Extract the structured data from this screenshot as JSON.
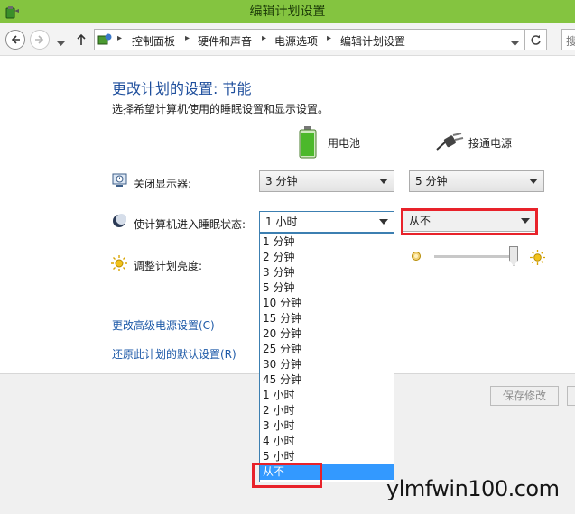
{
  "window": {
    "title": "编辑计划设置"
  },
  "address": {
    "crumbs": [
      "控制面板",
      "硬件和声音",
      "电源选项",
      "编辑计划设置"
    ],
    "search_placeholder": "搜"
  },
  "page": {
    "heading": "更改计划的设置: 节能",
    "subheading": "选择希望计算机使用的睡眠设置和显示设置。"
  },
  "columns": {
    "battery": "用电池",
    "plugged_in": "接通电源"
  },
  "settings": {
    "display_label": "关闭显示器:",
    "display_battery": "3 分钟",
    "display_ac": "5 分钟",
    "sleep_label": "使计算机进入睡眠状态:",
    "sleep_battery": "1 小时",
    "sleep_ac": "从不",
    "brightness_label": "调整计划亮度:",
    "brightness_ac_level_fraction": 0.95
  },
  "links": {
    "advanced": "更改高级电源设置(C)",
    "restore": "还原此计划的默认设置(R)"
  },
  "buttons": {
    "save": "保存修改"
  },
  "dropdown_options": [
    "1 分钟",
    "2 分钟",
    "3 分钟",
    "5 分钟",
    "10 分钟",
    "15 分钟",
    "20 分钟",
    "25 分钟",
    "30 分钟",
    "45 分钟",
    "1 小时",
    "2 小时",
    "3 小时",
    "4 小时",
    "5 小时",
    "从不"
  ],
  "dropdown_selected": "从不",
  "watermark": "ylmfwin100.com",
  "colors": {
    "titlebar": "#84c440",
    "link": "#1e5aa8",
    "highlight": "#e8222a",
    "selection": "#3399ff"
  }
}
